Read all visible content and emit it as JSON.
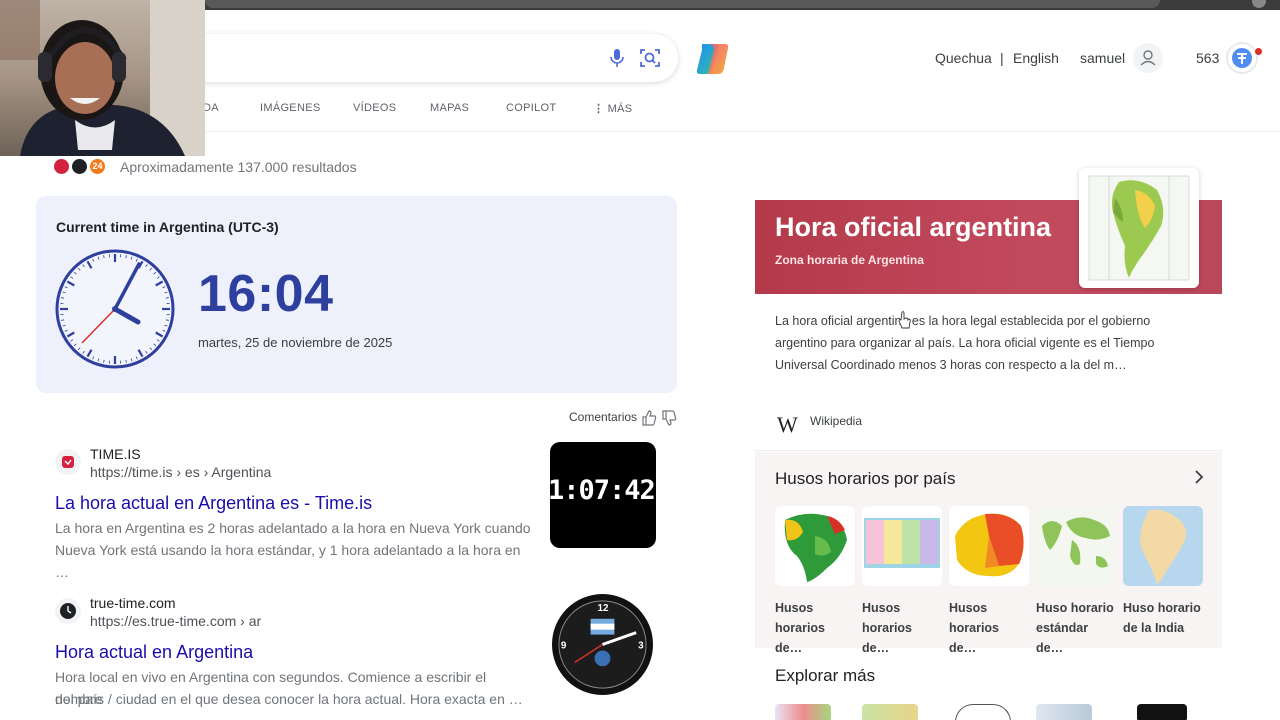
{
  "header": {
    "language_links": [
      "Quechua",
      "|",
      "English"
    ],
    "user_name": "samuel",
    "rewards_points": "563",
    "nav_tabs": [
      "DA",
      "IMÁGENES",
      "VÍDEOS",
      "MAPAS",
      "COPILOT",
      "MÁS"
    ]
  },
  "results_stats": "Aproximadamente 137.000 resultados",
  "stat_badge_text": "24",
  "time_card": {
    "title": "Current time in Argentina (UTC-3)",
    "time": "16:04",
    "date": "martes, 25 de noviembre de 2025"
  },
  "feedback_label": "Comentarios",
  "results": [
    {
      "site_name": "TIME.IS",
      "url": "https://time.is › es › Argentina",
      "title": "La hora actual en Argentina es - Time.is",
      "snippet_1": "La hora en Argentina es 2 horas adelantado a la hora en Nueva York cuando",
      "snippet_2": "Nueva York está usando la hora estándar, y 1 hora adelantado a la hora en …",
      "thumb_text": "1:07:42"
    },
    {
      "site_name": "true-time.com",
      "url": "https://es.true-time.com › ar",
      "title": "Hora actual en Argentina",
      "snippet_1": "Hora local en vivo en Argentina con segundos. Comience a escribir el nombre",
      "snippet_2": "del país / ciudad en el que desea conocer la hora actual. Hora exacta en …"
    }
  ],
  "knowledge_panel": {
    "title": "Hora oficial argentina",
    "subtitle": "Zona horaria de Argentina",
    "description_1": "La hora oficial argentina es la hora legal establecida por el gobierno",
    "description_2": "argentino para organizar al país. La hora oficial vigente es el Tiempo",
    "description_3": "Universal Coordinado menos 3 horas con respecto a la del m…",
    "source": "Wikipedia",
    "section_title": "Husos horarios por país",
    "timezone_cards": [
      {
        "line1": "Husos",
        "line2": "horarios de…"
      },
      {
        "line1": "Husos",
        "line2": "horarios de…"
      },
      {
        "line1": "Husos",
        "line2": "horarios de…"
      },
      {
        "line1": "Huso horario",
        "line2": "estándar de…"
      },
      {
        "line1": "Huso horario",
        "line2": "de la India"
      }
    ],
    "explore_title": "Explorar más"
  },
  "colors": {
    "link_title": "#1a0dab",
    "time_digits": "#2e3f9e",
    "panel_header": "#b43a4a",
    "time_card_bg": "#eef1fb"
  }
}
